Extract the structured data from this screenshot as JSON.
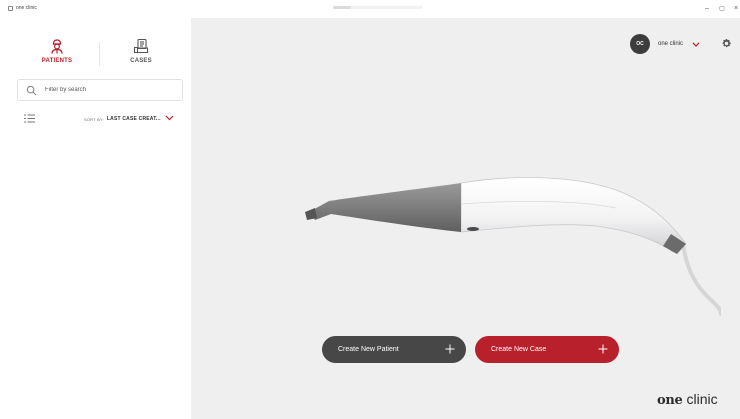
{
  "window": {
    "title": "one clinic",
    "controls": {
      "minimize": "–",
      "maximize": "▢",
      "close": "×"
    }
  },
  "sidebar": {
    "tabs": [
      {
        "label": "PATIENTS",
        "icon": "patient-icon",
        "active": true
      },
      {
        "label": "CASES",
        "icon": "cases-icon",
        "active": false
      }
    ],
    "search": {
      "placeholder": "Filter by search",
      "value": ""
    },
    "sort": {
      "prefix": "SORT BY:",
      "value": "LAST CASE CREAT..."
    }
  },
  "main": {
    "account": {
      "initials": "OC",
      "name": "one clinic"
    },
    "buttons": {
      "create_patient": "Create New Patient",
      "create_case": "Create New Case"
    },
    "brand": {
      "part1": "one",
      "part2": "clinic"
    }
  },
  "colors": {
    "accent": "#b8212b",
    "dark_button": "#474747",
    "main_background": "#efeff0",
    "avatar": "#3d3d3d"
  }
}
